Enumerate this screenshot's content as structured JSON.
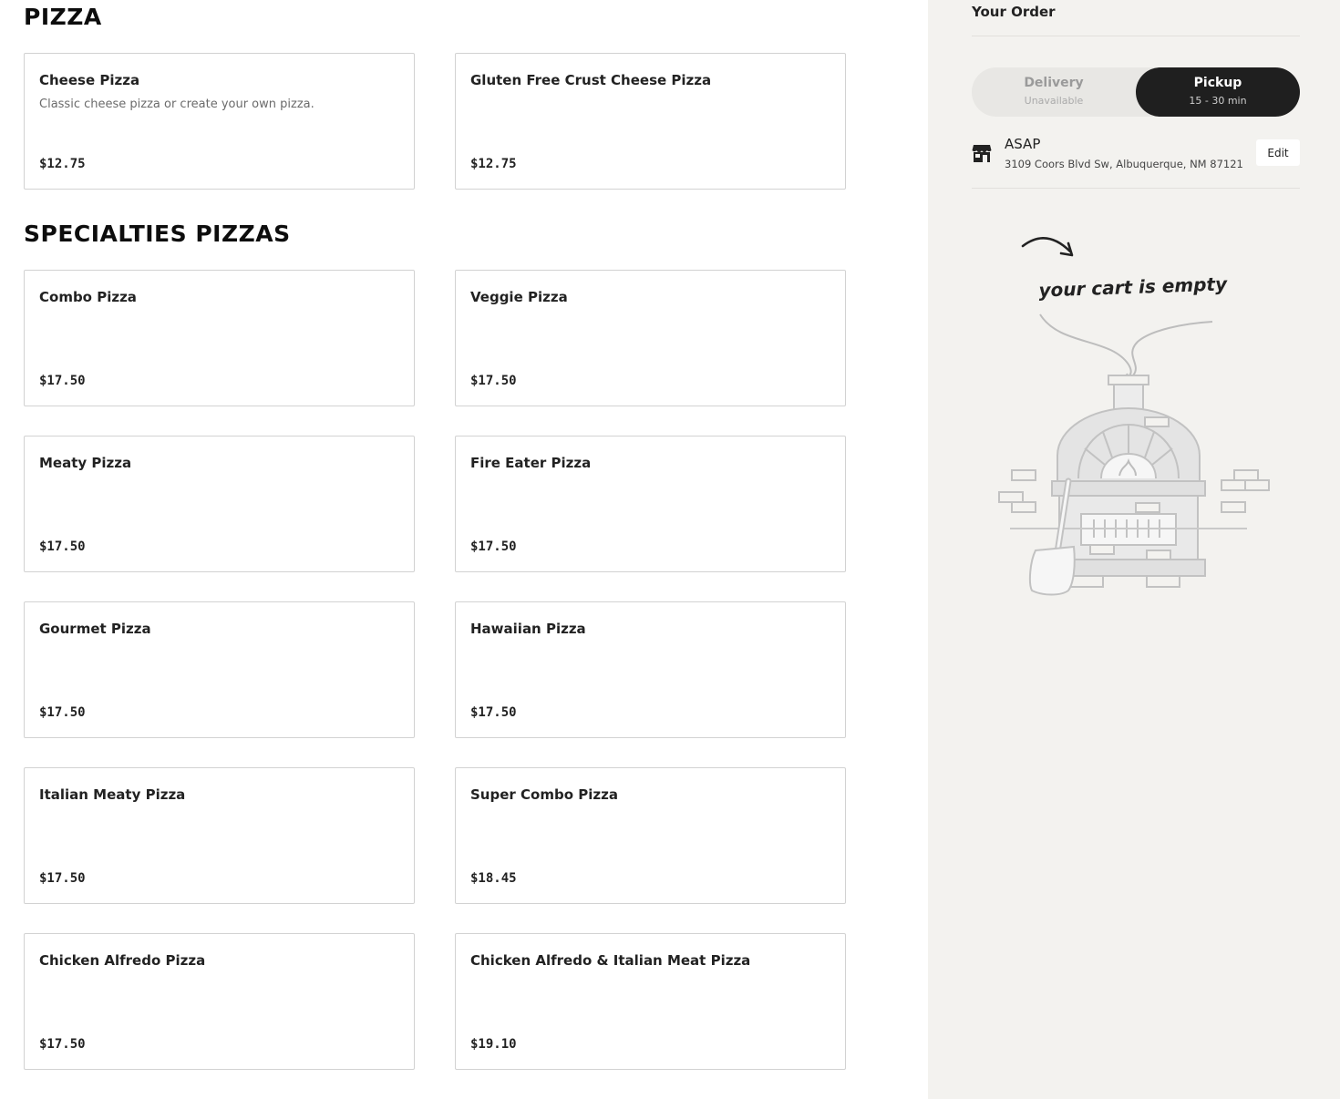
{
  "sections": [
    {
      "title": "PIZZA",
      "items": [
        {
          "name": "Cheese Pizza",
          "description": "Classic cheese pizza or create your own pizza.",
          "price": "$12.75"
        },
        {
          "name": "Gluten Free Crust Cheese Pizza",
          "description": "",
          "price": "$12.75"
        }
      ]
    },
    {
      "title": "SPECIALTIES PIZZAS",
      "items": [
        {
          "name": "Combo Pizza",
          "description": "",
          "price": "$17.50"
        },
        {
          "name": "Veggie Pizza",
          "description": "",
          "price": "$17.50"
        },
        {
          "name": "Meaty Pizza",
          "description": "",
          "price": "$17.50"
        },
        {
          "name": "Fire Eater Pizza",
          "description": "",
          "price": "$17.50"
        },
        {
          "name": "Gourmet Pizza",
          "description": "",
          "price": "$17.50"
        },
        {
          "name": "Hawaiian Pizza",
          "description": "",
          "price": "$17.50"
        },
        {
          "name": "Italian Meaty Pizza",
          "description": "",
          "price": "$17.50"
        },
        {
          "name": "Super Combo Pizza",
          "description": "",
          "price": "$18.45"
        },
        {
          "name": "Chicken Alfredo Pizza",
          "description": "",
          "price": "$17.50"
        },
        {
          "name": "Chicken Alfredo & Italian Meat Pizza",
          "description": "",
          "price": "$19.10"
        }
      ]
    }
  ],
  "order": {
    "title": "Your Order",
    "delivery": {
      "label": "Delivery",
      "sub": "Unavailable",
      "selected": false
    },
    "pickup": {
      "label": "Pickup",
      "sub": "15 - 30 min",
      "selected": true
    },
    "time_label": "ASAP",
    "address": "3109 Coors Blvd Sw, Albuquerque, NM 87121",
    "edit_label": "Edit",
    "store_icon": "storefront-icon",
    "empty_message": "your cart is empty",
    "empty_illustration_icon": "pizza-oven-illustration"
  },
  "colors": {
    "sidebar_bg": "#f3f2ef",
    "pickup_active_bg": "#1f1f1f",
    "card_border": "#d2d2d2"
  }
}
